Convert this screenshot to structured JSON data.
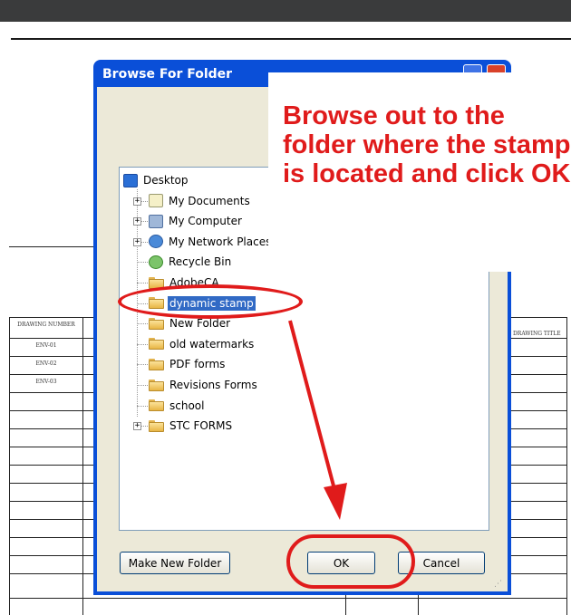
{
  "dialog": {
    "title": "Browse For Folder",
    "buttons": {
      "make_new_folder": "Make New Folder",
      "ok": "OK",
      "cancel": "Cancel"
    }
  },
  "tree": {
    "items": [
      {
        "label": "Desktop",
        "icon": "desktop-icon",
        "expander": ""
      },
      {
        "label": "My Documents",
        "icon": "my-documents-icon",
        "expander": "+"
      },
      {
        "label": "My Computer",
        "icon": "my-computer-icon",
        "expander": "+"
      },
      {
        "label": "My Network Places",
        "icon": "network-places-icon",
        "expander": "+"
      },
      {
        "label": "Recycle Bin",
        "icon": "recycle-bin-icon",
        "expander": ""
      },
      {
        "label": "AdobeCA",
        "icon": "folder-icon",
        "expander": ""
      },
      {
        "label": "dynamic stamp",
        "icon": "folder-icon",
        "expander": "",
        "selected": true
      },
      {
        "label": "New Folder",
        "icon": "folder-icon",
        "expander": ""
      },
      {
        "label": "old watermarks",
        "icon": "folder-icon",
        "expander": ""
      },
      {
        "label": "PDF forms",
        "icon": "folder-icon",
        "expander": ""
      },
      {
        "label": "Revisions Forms",
        "icon": "folder-icon",
        "expander": ""
      },
      {
        "label": "school",
        "icon": "folder-icon",
        "expander": ""
      },
      {
        "label": "STC FORMS",
        "icon": "folder-icon",
        "expander": "+"
      }
    ]
  },
  "annotation": {
    "text": "Browse out to the folder where the stamp is located and click OK",
    "color": "#e01b1b"
  },
  "document": {
    "left_header": "DRAWING NUMBER",
    "rows": [
      "ENV-01",
      "ENV-02",
      "ENV-03"
    ],
    "right_header": "DRAWING TITLE"
  },
  "colors": {
    "titlebar": "#0a4fd8",
    "dialog_face": "#ece9d8",
    "selection": "#316ac5"
  }
}
